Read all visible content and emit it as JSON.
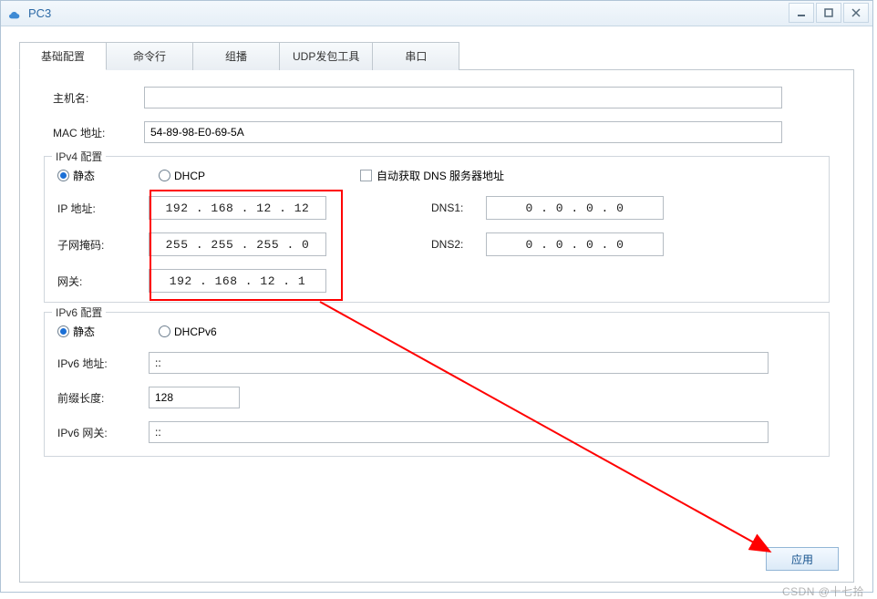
{
  "window": {
    "title": "PC3"
  },
  "tabs": {
    "basic": "基础配置",
    "cmd": "命令行",
    "mcast": "组播",
    "udp": "UDP发包工具",
    "serial": "串口"
  },
  "basic": {
    "hostname_label": "主机名:",
    "hostname_value": "",
    "mac_label": "MAC 地址:",
    "mac_value": "54-89-98-E0-69-5A"
  },
  "ipv4": {
    "legend": "IPv4 配置",
    "static_label": "静态",
    "dhcp_label": "DHCP",
    "auto_dns_label": "自动获取 DNS 服务器地址",
    "ip_label": "IP 地址:",
    "ip_value": "192 . 168 .  12  .  12",
    "mask_label": "子网掩码:",
    "mask_value": "255 . 255 . 255 .  0",
    "gw_label": "网关:",
    "gw_value": "192 . 168 .  12  .  1",
    "dns1_label": "DNS1:",
    "dns1_value": "0  .  0  .  0  .  0",
    "dns2_label": "DNS2:",
    "dns2_value": "0  .  0  .  0  .  0"
  },
  "ipv6": {
    "legend": "IPv6 配置",
    "static_label": "静态",
    "dhcpv6_label": "DHCPv6",
    "addr_label": "IPv6 地址:",
    "addr_value": "::",
    "prefix_label": "前缀长度:",
    "prefix_value": "128",
    "gw_label": "IPv6 网关:",
    "gw_value": "::"
  },
  "apply_label": "应用",
  "watermark": "CSDN @十七拾"
}
